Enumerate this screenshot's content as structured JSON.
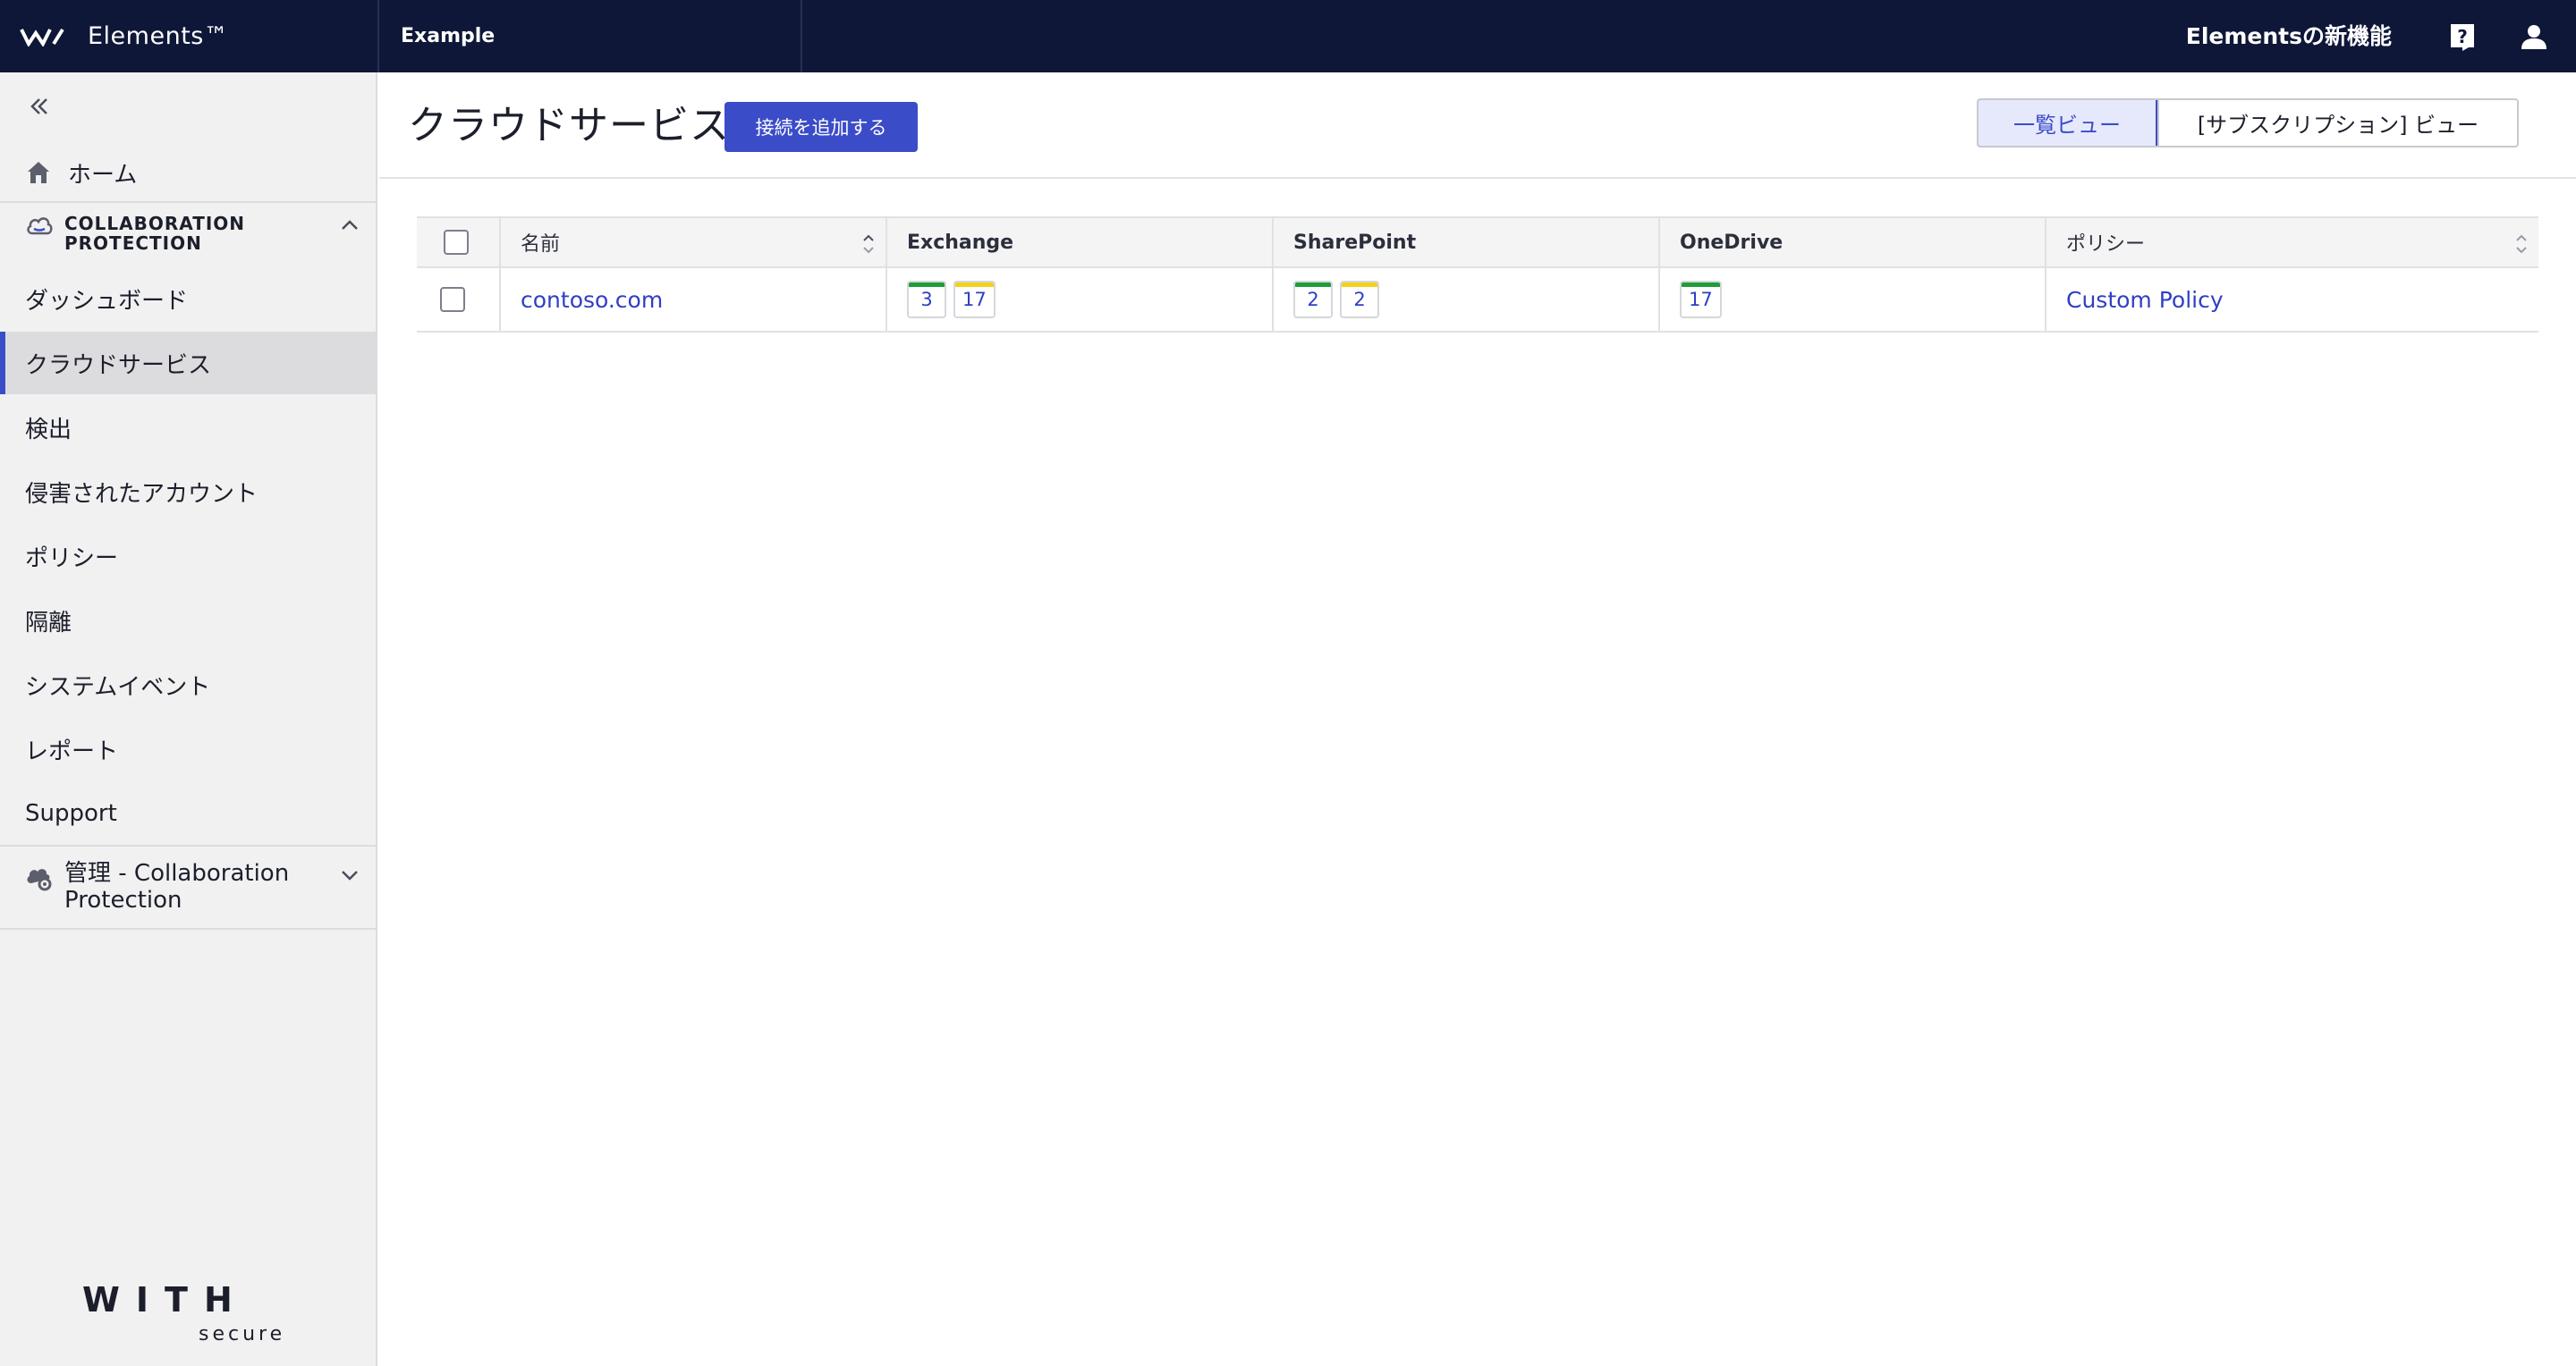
{
  "topbar": {
    "brand_name": "Elements™",
    "org_name": "Example",
    "whats_new": "Elementsの新機能"
  },
  "sidebar": {
    "home": "ホーム",
    "section_title": "COLLABORATION PROTECTION",
    "items": [
      {
        "label": "ダッシュボード"
      },
      {
        "label": "クラウドサービス"
      },
      {
        "label": "検出"
      },
      {
        "label": "侵害されたアカウント"
      },
      {
        "label": "ポリシー"
      },
      {
        "label": "隔離"
      },
      {
        "label": "システムイベント"
      },
      {
        "label": "レポート"
      },
      {
        "label": "Support"
      }
    ],
    "admin_title": "管理 - Collaboration Protection",
    "logo_text": "WITH",
    "logo_subtext": "secure"
  },
  "main": {
    "title": "クラウドサービス",
    "add_button": "接続を追加する",
    "view_list": "一覧ビュー",
    "view_subscription": "[サブスクリプション] ビュー"
  },
  "table": {
    "columns": [
      "名前",
      "Exchange",
      "SharePoint",
      "OneDrive",
      "ポリシー"
    ],
    "rows": [
      {
        "name": "contoso.com",
        "exchange": [
          {
            "value": "3",
            "color": "#1f9d3a"
          },
          {
            "value": "17",
            "color": "#f2d21b"
          }
        ],
        "sharepoint": [
          {
            "value": "2",
            "color": "#1f9d3a"
          },
          {
            "value": "2",
            "color": "#f2d21b"
          }
        ],
        "onedrive": [
          {
            "value": "17",
            "color": "#1f9d3a"
          }
        ],
        "policy": "Custom Policy"
      }
    ]
  },
  "colors": {
    "topbar_bg": "#0f1738",
    "accent": "#3b4cc8",
    "link": "#2f3fc4",
    "badge_green": "#1f9d3a",
    "badge_yellow": "#f2d21b"
  }
}
